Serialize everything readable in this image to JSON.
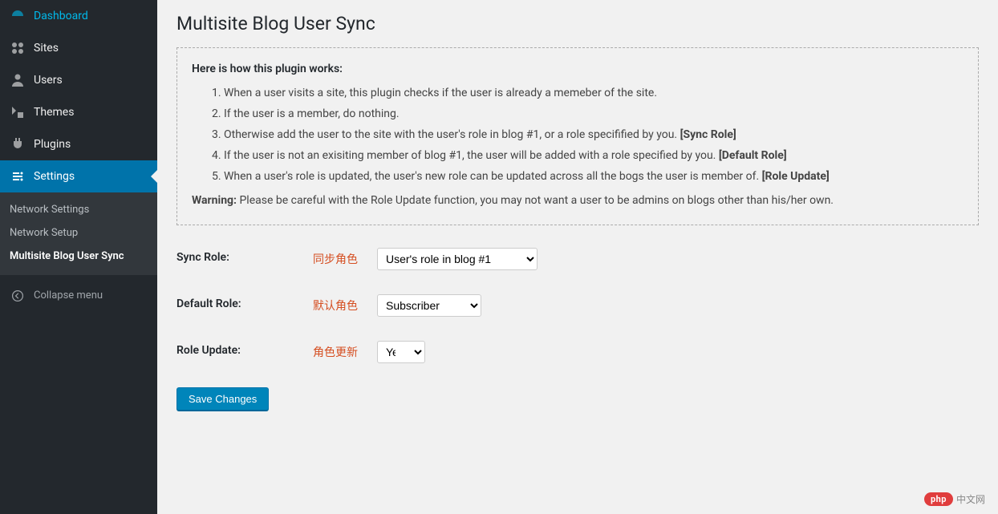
{
  "sidebar": {
    "items": [
      {
        "label": "Dashboard",
        "icon": "dashboard",
        "name": "sidebar-item-dashboard"
      },
      {
        "label": "Sites",
        "icon": "sites",
        "name": "sidebar-item-sites"
      },
      {
        "label": "Users",
        "icon": "users",
        "name": "sidebar-item-users"
      },
      {
        "label": "Themes",
        "icon": "themes",
        "name": "sidebar-item-themes"
      },
      {
        "label": "Plugins",
        "icon": "plugins",
        "name": "sidebar-item-plugins"
      },
      {
        "label": "Settings",
        "icon": "settings",
        "name": "sidebar-item-settings",
        "current": true
      }
    ],
    "submenu": [
      {
        "label": "Network Settings",
        "name": "submenu-network-settings"
      },
      {
        "label": "Network Setup",
        "name": "submenu-network-setup"
      },
      {
        "label": "Multisite Blog User Sync",
        "name": "submenu-multisite-blog-user-sync",
        "current": true
      }
    ],
    "collapse_label": "Collapse menu"
  },
  "page": {
    "title": "Multisite Blog User Sync"
  },
  "infobox": {
    "heading": "Here is how this plugin works:",
    "items": [
      {
        "text": "When a user visits a site, this plugin checks if the user is already a memeber of the site."
      },
      {
        "text": "If the user is a member, do nothing."
      },
      {
        "text": "Otherwise add the user to the site with the user's role in blog #1, or a role specifified by you. ",
        "bold": "[Sync Role]"
      },
      {
        "text": "If the user is not an exisiting member of blog #1, the user will be added with a role specified by you. ",
        "bold": "[Default Role]"
      },
      {
        "text": "When a user's role is updated, the user's new role can be updated across all the bogs the user is member of. ",
        "bold": "[Role Update]"
      }
    ],
    "warning_label": "Warning:",
    "warning_text": " Please be careful with the Role Update function, you may not want a user to be admins on blogs other than his/her own."
  },
  "form": {
    "sync_role": {
      "label": "Sync Role:",
      "annot": "同步角色",
      "value": "User's role in blog #1"
    },
    "default_role": {
      "label": "Default Role:",
      "annot": "默认角色",
      "value": "Subscriber"
    },
    "role_update": {
      "label": "Role Update:",
      "annot": "角色更新",
      "value": "Yes"
    },
    "submit_label": "Save Changes"
  },
  "watermark": {
    "badge": "php",
    "text": "中文网"
  }
}
